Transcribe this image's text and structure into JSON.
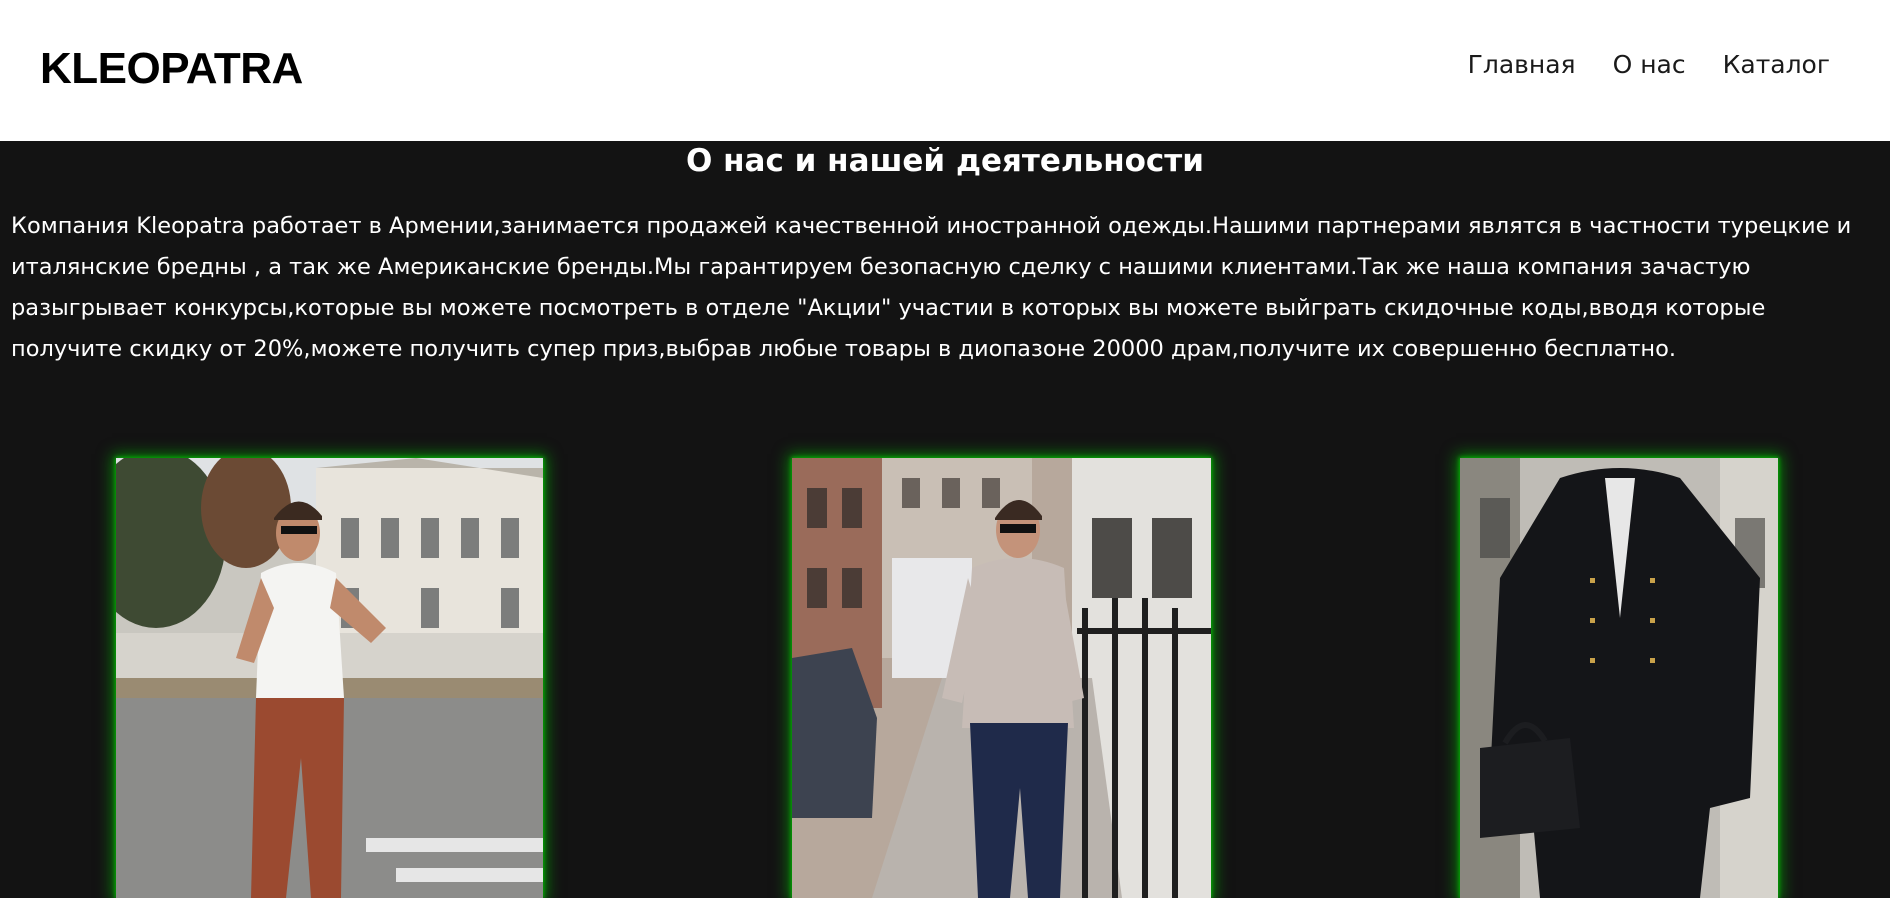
{
  "header": {
    "logo": "KLEOPATRA",
    "nav": [
      {
        "label": "Главная"
      },
      {
        "label": "О нас"
      },
      {
        "label": "Каталог"
      }
    ]
  },
  "about": {
    "title": "О нас и нашей деятельности",
    "text": "Компания Kleopatra работает в Армении,занимается продажей качественной иностранной одежды.Нашими партнерами являтся в частности турецкие и италянские бредны , а так же Американские бренды.Мы гарантируем безопасную сделку с нашими клиентами.Так же наша компания зачастую разыгрывает конкурсы,которые вы можете посмотреть в отделе \"Акции\" участии в которых вы можете выйграть скидочные коды,вводя которые получите скидку от 20%,можете получить супер приз,выбрав любые товары в диопазоне 20000 драм,получите их совершенно бесплатно."
  },
  "gallery": {
    "glow_color": "#00c800",
    "photos": [
      {
        "icon": "man-white-tshirt-photo"
      },
      {
        "icon": "man-grey-sweater-photo"
      },
      {
        "icon": "man-black-coat-photo"
      }
    ]
  }
}
